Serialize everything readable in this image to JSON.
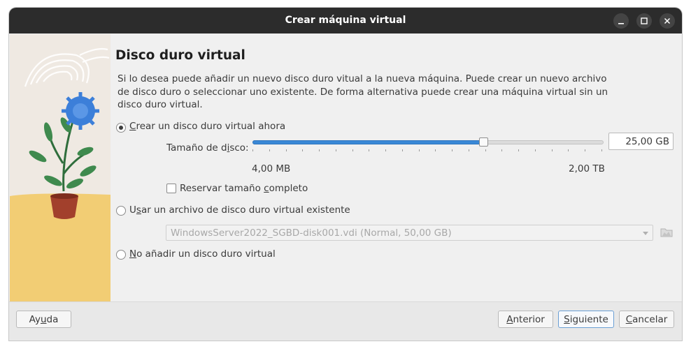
{
  "window": {
    "title": "Crear máquina virtual",
    "controls": [
      "minimize-icon",
      "maximize-icon",
      "close-icon"
    ]
  },
  "page": {
    "heading": "Disco duro virtual",
    "description": "Si lo desea puede añadir un nuevo disco duro vitual a la nueva máquina. Puede crear un nuevo archivo de disco duro o seleccionar uno existente. De forma alternativa puede crear una máquina virtual sin un disco duro virtual."
  },
  "options": {
    "create": {
      "label_pre": "",
      "label_key": "C",
      "label_post": "rear un disco duro virtual ahora",
      "selected": true
    },
    "existing": {
      "label_pre": "U",
      "label_key": "s",
      "label_post": "ar un archivo de disco duro virtual existente",
      "selected": false
    },
    "none": {
      "label_pre": "",
      "label_key": "N",
      "label_post": "o añadir un disco duro virtual",
      "selected": false
    }
  },
  "disk_size": {
    "label_pre": "Tamaño de d",
    "label_key": "i",
    "label_post": "sco:",
    "value": "25,00 GB",
    "slider_fraction": 0.66,
    "tick_count": 22,
    "min_label": "4,00 MB",
    "max_label": "2,00 TB"
  },
  "preallocate": {
    "label_pre": "Reservar tamaño ",
    "label_key": "c",
    "label_post": "ompleto",
    "checked": false
  },
  "existing_file": {
    "value": "WindowsServer2022_SGBD-disk001.vdi (Normal, 50,00 GB)",
    "icon": "folder-icon",
    "enabled": false
  },
  "buttons": {
    "help": {
      "pre": "Ay",
      "key": "u",
      "post": "da"
    },
    "back": {
      "pre": "",
      "key": "A",
      "post": "nterior"
    },
    "next": {
      "pre": "",
      "key": "S",
      "post": "iguiente"
    },
    "cancel": {
      "pre": "",
      "key": "C",
      "post": "ancelar"
    }
  },
  "colors": {
    "accent": "#3a88d6",
    "titlebar": "#2c2c2c",
    "sidebar_sand": "#f2cd74",
    "flower": "#3c7fd9",
    "pot": "#a2402c"
  }
}
